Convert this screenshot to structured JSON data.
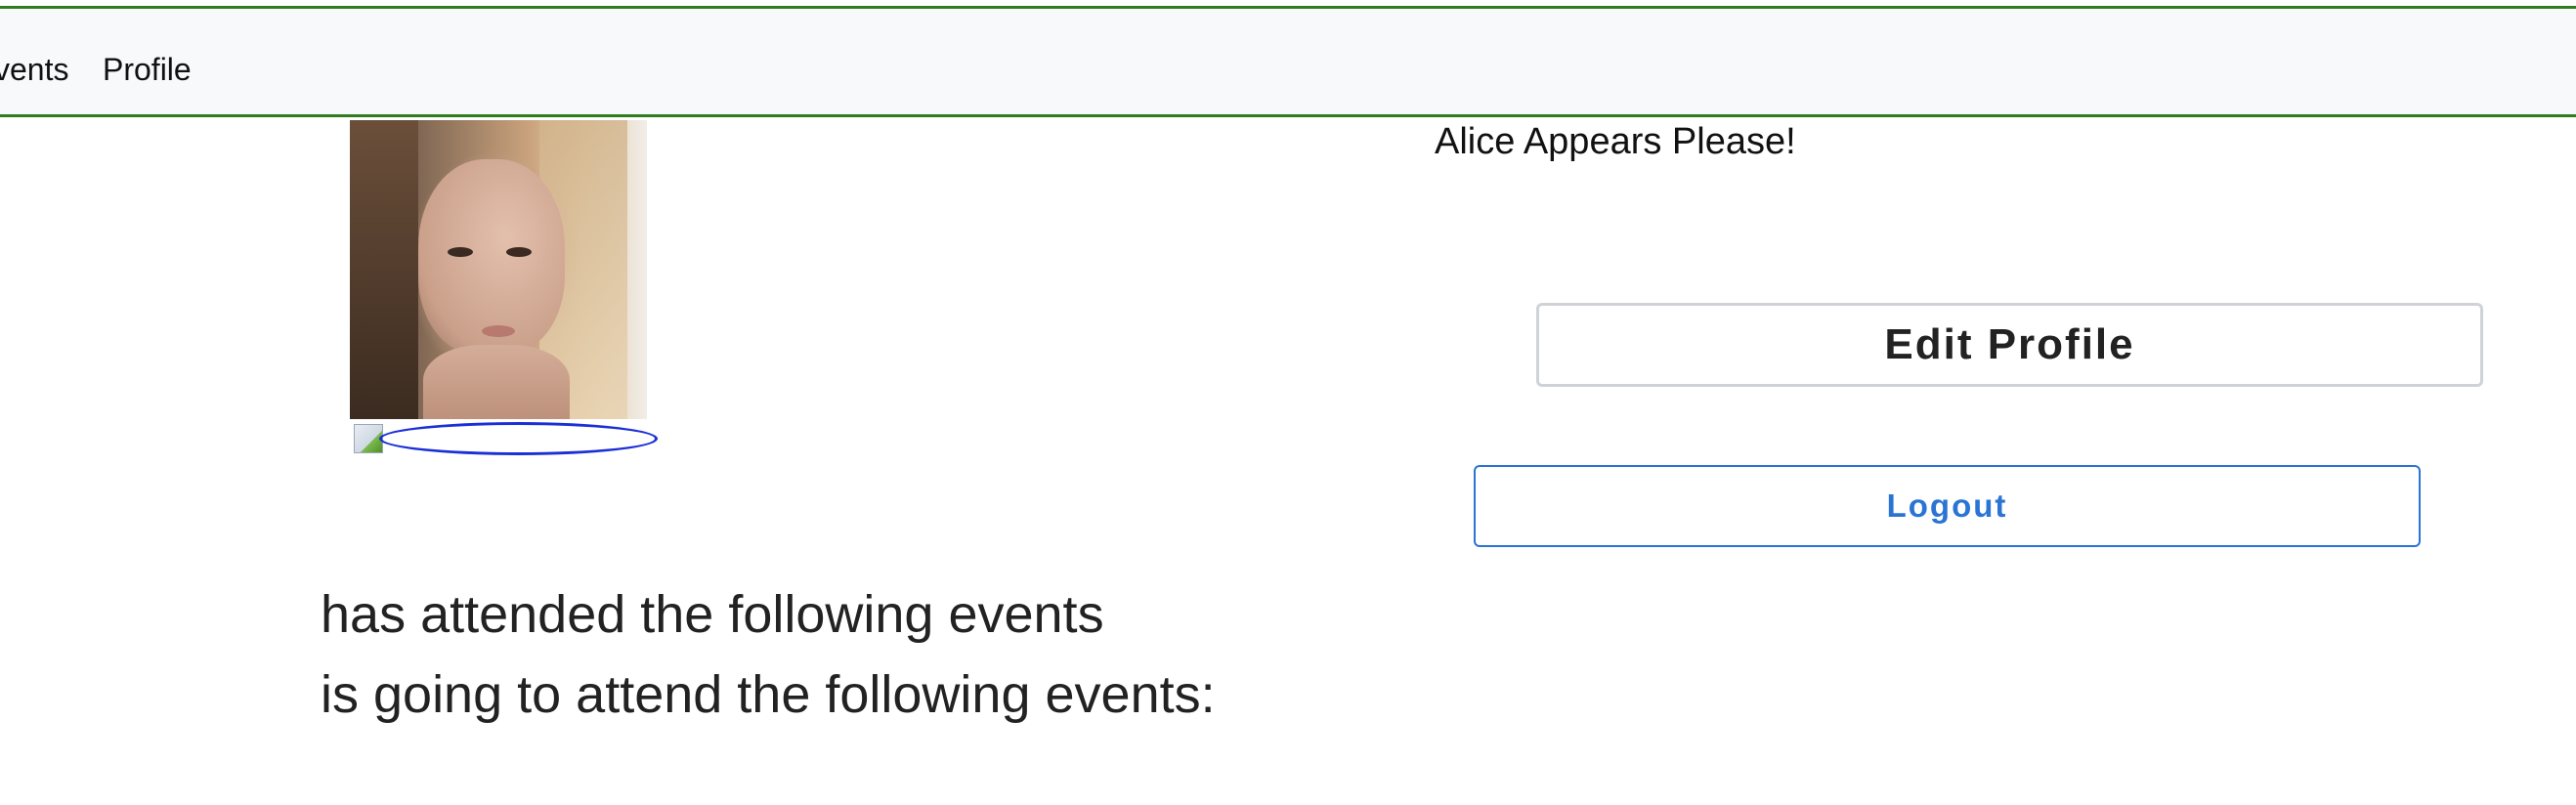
{
  "nav": {
    "events_label": "Events",
    "events_visible": "vents",
    "profile_label": "Profile"
  },
  "profile": {
    "name": "Alice Appears Please!",
    "edit_button_label": "Edit Profile",
    "logout_button_label": "Logout"
  },
  "events": {
    "attended_text": "has attended the following events",
    "upcoming_text": "is going to attend the following events:"
  },
  "colors": {
    "navbar_border": "#2e7d1e",
    "navbar_bg": "#f8f9fa",
    "logout_accent": "#2b74d4",
    "username_ellipse": "#1a2fd6"
  }
}
